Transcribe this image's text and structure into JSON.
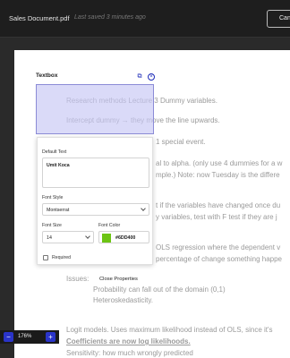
{
  "header": {
    "doc_title": "Sales Document.pdf",
    "saved_status": "Last saved 3 minutes ago",
    "button_label": "Can"
  },
  "document": {
    "lines": [
      "Research methods Lecture 3 Dummy variables.",
      "Intercept dummy → they move the line upwards.",
      "1 special event.",
      "al to alpha. (only use 4 dummies for a w",
      "mple.) Note: now Tuesday is the differe",
      "t if the variables have changed once du",
      "y variables, test with F test if they are j",
      "OLS regression where the dependent v",
      "percentage of change something happe",
      "Issues:",
      "Probability can fall out of the domain (0,1)",
      "Heteroskedasticity.",
      "Logit models. Uses maximum likelihood instead of OLS, since it's",
      "Coefficients are now log likelihoods.",
      "Sensitivity: how much wrongly predicted"
    ]
  },
  "textbox": {
    "label": "Textbox",
    "copy_icon": "copy-icon",
    "close_icon": "close-circle-icon"
  },
  "properties": {
    "default_text_label": "Default Text",
    "default_text_value": "Umit Koca",
    "font_style_label": "Font Style",
    "font_style_value": "Montserrat",
    "font_size_label": "Font Size",
    "font_size_value": "14",
    "font_color_label": "Font Color",
    "font_color_value": "#6DD400",
    "font_color_swatch": "#6cc413",
    "required_label": "Required",
    "close_label": "Close Properties"
  },
  "zoom": {
    "value": "176%",
    "zoom_out_icon": "zoom-out-icon",
    "zoom_in_icon": "zoom-in-icon"
  },
  "colors": {
    "accent": "#2a34c9",
    "textbox_fill": "#c6c6f5",
    "top_bar": "#1e1e1e"
  }
}
